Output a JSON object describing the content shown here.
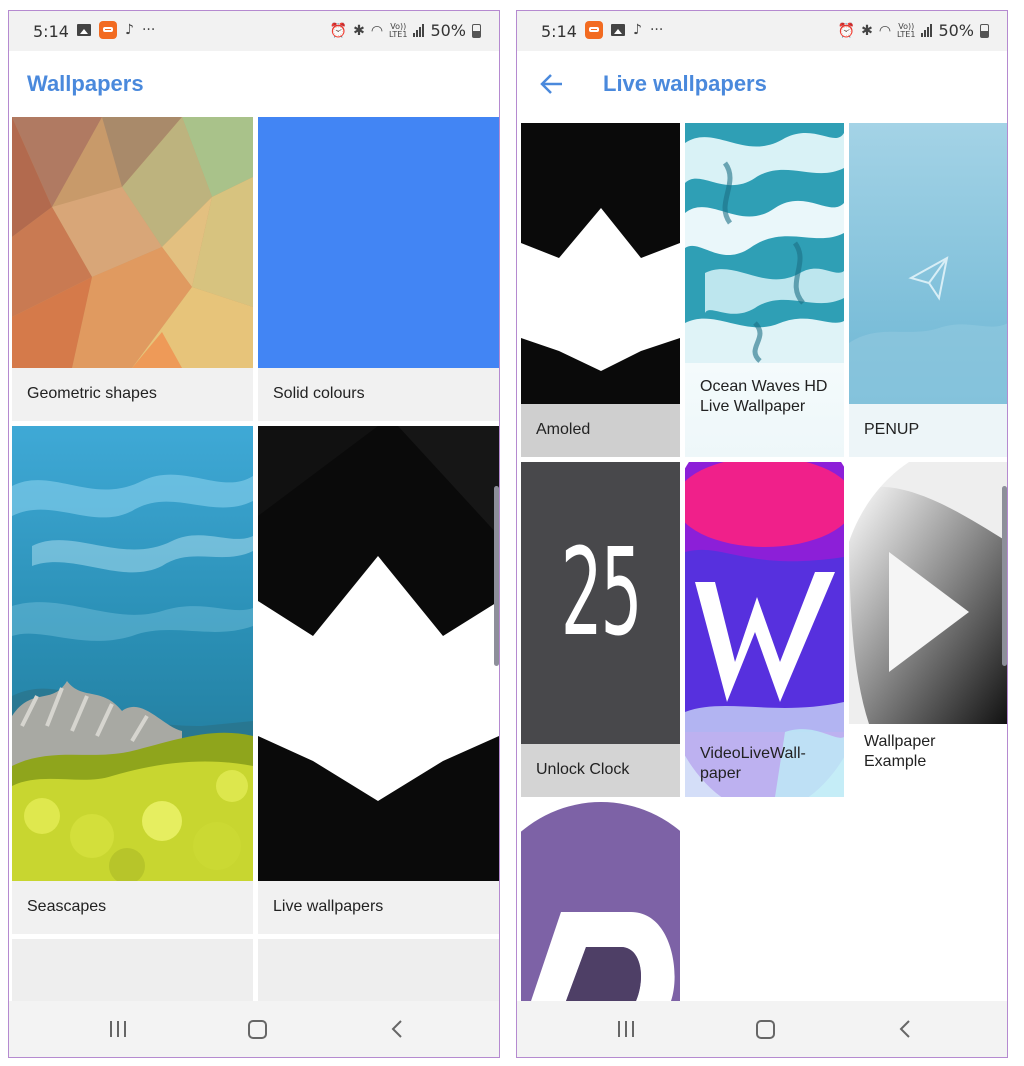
{
  "status_bar": {
    "time": "5:14",
    "battery": "50%",
    "dots": "···",
    "note": "♪",
    "alarm": "⏰",
    "bluetooth": "✱",
    "wifi": "◠",
    "volte_top": "Vo))",
    "volte_bottom": "LTE1"
  },
  "left_screen": {
    "title": "Wallpapers",
    "tiles": [
      {
        "label": "Geometric shapes"
      },
      {
        "label": "Solid colours"
      },
      {
        "label": "Seascapes"
      },
      {
        "label": "Live wallpapers"
      }
    ]
  },
  "right_screen": {
    "title": "Live wallpapers",
    "tiles": [
      {
        "label": "Amoled"
      },
      {
        "label": "Ocean Waves HD Live Wallpaper"
      },
      {
        "label": "PENUP"
      },
      {
        "label": "Unlock Clock",
        "art": "25"
      },
      {
        "label": "VideoLiveWall-paper"
      },
      {
        "label": "Wallpaper Example"
      }
    ]
  },
  "colors": {
    "accent": "#4a89dc",
    "solid_colour": "#4285f4"
  },
  "icons": [
    "gallery-icon",
    "app-notification-icon",
    "music-note-icon",
    "more-icon",
    "alarm-icon",
    "bluetooth-icon",
    "wifi-icon",
    "volte-icon",
    "signal-icon",
    "battery-icon",
    "back-arrow-icon",
    "recent-apps-icon",
    "home-icon",
    "nav-back-icon"
  ]
}
